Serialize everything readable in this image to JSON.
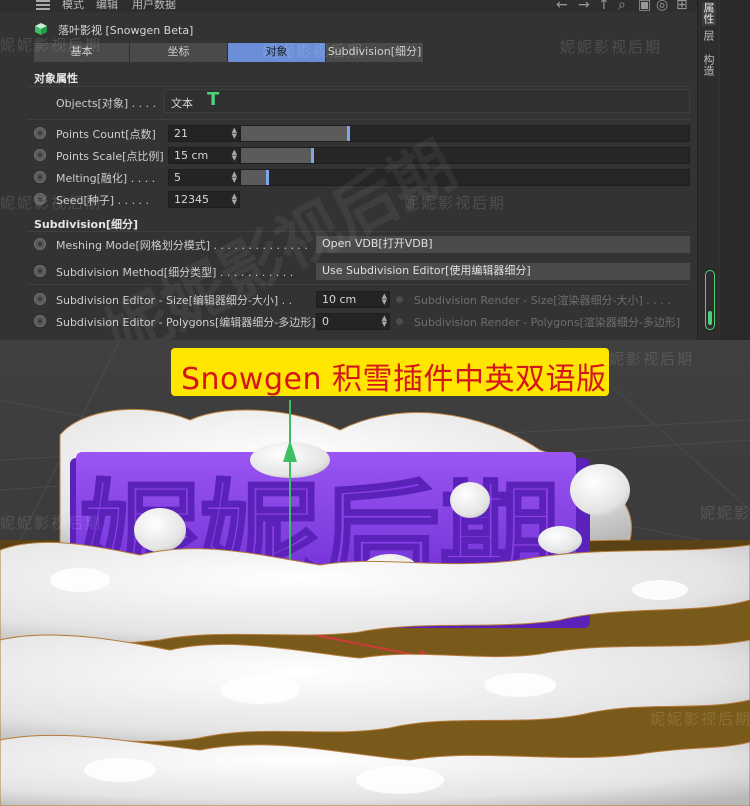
{
  "menubar": {
    "items": [
      "模式",
      "编辑",
      "用户数据"
    ]
  },
  "object": {
    "title": "落叶影视 [Snowgen Beta]"
  },
  "tabs": [
    {
      "label": "基本",
      "active": false
    },
    {
      "label": "坐标",
      "active": false
    },
    {
      "label": "对象",
      "active": true
    },
    {
      "label": "Subdivision[细分]",
      "active": false
    }
  ],
  "sections": {
    "object_props": "对象属性",
    "subdivision": "Subdivision[细分]"
  },
  "objects_field": {
    "label": "Objects[对象] . . . .",
    "value": "文本"
  },
  "params": [
    {
      "label": "Points Count[点数]",
      "value": "21",
      "slider": 0.24
    },
    {
      "label": "Points Scale[点比例]",
      "value": "15 cm",
      "slider": 0.16
    },
    {
      "label": "Melting[融化] . . . .",
      "value": "5",
      "slider": 0.06
    },
    {
      "label": "Seed[种子] . . . . .",
      "value": "12345"
    }
  ],
  "subdivision": {
    "meshing_label": "Meshing Mode[网格划分模式] . . . . . . . . . . . . . .",
    "meshing_value": "Open VDB[打开VDB]",
    "method_label": "Subdivision Method[细分类型] . . . . . . . . . . .",
    "method_value": "Use Subdivision Editor[使用编辑器细分]",
    "editor_size_label": "Subdivision Editor - Size[编辑器细分-大小] . .",
    "editor_size_value": "10 cm",
    "render_size_label": "Subdivision Render - Size[渲染器细分-大小] . . . .",
    "editor_poly_label": "Subdivision Editor - Polygons[编辑器细分-多边形]",
    "editor_poly_value": "0",
    "render_poly_label": "Subdivision Render - Polygons[渲染器细分-多边形]"
  },
  "side_tabs": [
    "属性",
    "层",
    "构造"
  ],
  "banner": {
    "text": "Snowgen 积雪插件中英双语版"
  },
  "scene_text": "妮妮后期",
  "watermark": "妮妮影视后期",
  "colors": {
    "accent_tab": "#6a8fd8",
    "banner_bg": "#ffe600",
    "banner_text": "#d4151b",
    "text_purple": "#8a3ee6",
    "ground": "#7a5a1a"
  }
}
